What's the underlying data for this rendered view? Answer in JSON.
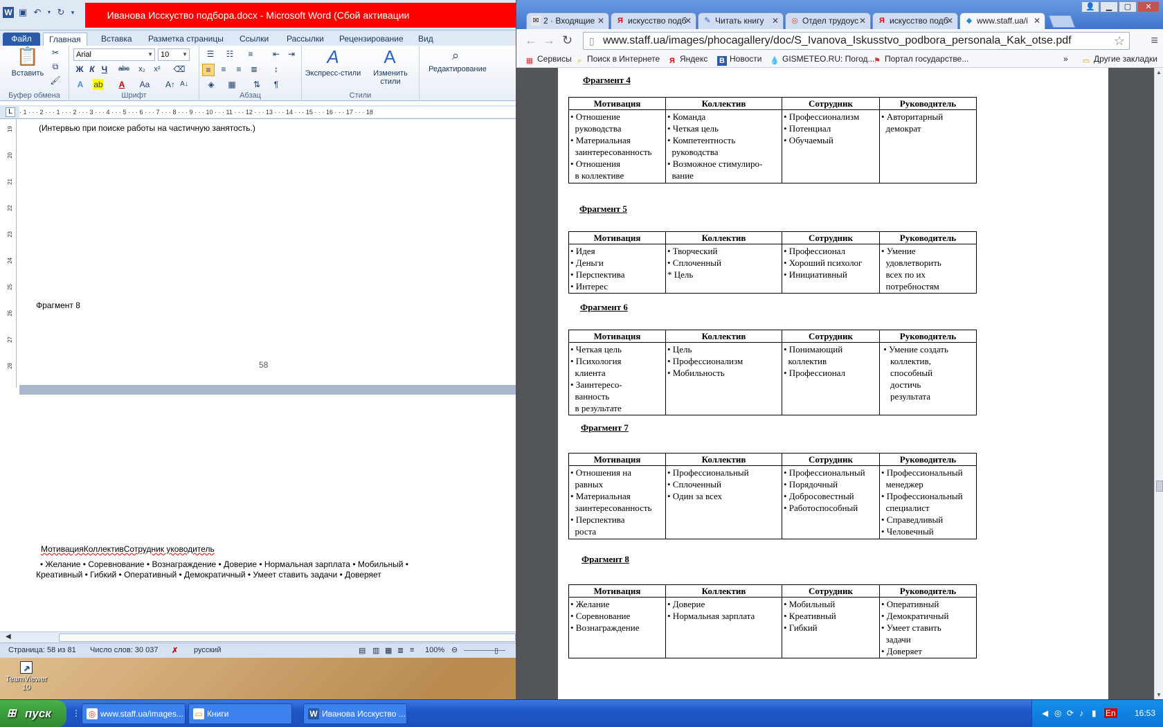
{
  "word": {
    "title": "Иванова Исскуство подбора.docx - Microsoft Word (Сбой активации продукта)",
    "tabs": [
      {
        "label": "Файл"
      },
      {
        "label": "Главная"
      },
      {
        "label": "Вставка"
      },
      {
        "label": "Разметка страницы"
      },
      {
        "label": "Ссылки"
      },
      {
        "label": "Рассылки"
      },
      {
        "label": "Рецензирование"
      },
      {
        "label": "Вид"
      }
    ],
    "ribbon": {
      "paste_label": "Вставить",
      "clipboard_group": "Буфер обмена",
      "font_name": "Arial",
      "font_size": "10",
      "font_group": "Шрифт",
      "bold": "Ж",
      "italic": "К",
      "underline": "Ч",
      "strike": "abc",
      "subscript": "x₂",
      "superscript": "x²",
      "paragraph_group": "Абзац",
      "styles_express": "Экспресс-стили",
      "styles_change": "Изменить стили",
      "styles_group": "Стили",
      "editing": "Редактирование"
    },
    "ruler_marks": "· 1 · · · 2 · · · 1 · · · 2 · · · 3 · · · 4 · · · 5 · · · 6 · · · 7 · · · 8 · · · 9 · · · 10 · · · 11 · · · 12 · · · 13 · · · 14 · · · 15 · · · 16 · · · 17 · · · 18",
    "vruler_marks": [
      "19",
      "20",
      "21",
      "22",
      "23",
      "24",
      "25",
      "26",
      "27",
      "28"
    ],
    "doc": {
      "line_interview": "(Интервью при поиске работы на частичную занятость.)",
      "fragment_label": "Фрагмент 8",
      "page_number": "58",
      "table_header_merged": "МотивацияКоллективСотрудник уководитель",
      "line_items_1": "• Желание  • Соревнование  • Вознаграждение  • Доверие • Нормальная зарплата • Мобильный •",
      "line_items_2": "Креативный  • Гибкий • Оперативный  • Демократичный  • Умеет ставить задачи • Доверяет"
    },
    "status": {
      "page": "Страница: 58 из 81",
      "words": "Число слов: 30 037",
      "language": "русский",
      "zoom": "100%"
    }
  },
  "teamviewer_label": "TeamViewer 10",
  "chrome": {
    "tabs": [
      {
        "label": "2 · Входящие"
      },
      {
        "label": "искусство подб"
      },
      {
        "label": "Читать книгу"
      },
      {
        "label": "Отдел трудоус"
      },
      {
        "label": "искусство подб"
      },
      {
        "label": "www.staff.ua/i"
      }
    ],
    "url": "www.staff.ua/images/phocagallery/doc/S_Ivanova_Iskusstvo_podbora_personala_Kak_otse.pdf",
    "bookmarks": [
      {
        "label": "Сервисы"
      },
      {
        "label": "Поиск в Интернете"
      },
      {
        "label": "Яндекс"
      },
      {
        "label": "Новости"
      },
      {
        "label": "GISMETEO.RU: Погод..."
      },
      {
        "label": "Портал государстве..."
      }
    ],
    "bookmarks_more": "»",
    "other_bookmarks": "Другие закладки"
  },
  "pdf": {
    "headers": [
      "Мотивация",
      "Коллектив",
      "Сотрудник",
      "Руководитель"
    ],
    "fragments": [
      {
        "title": "Фрагмент 4",
        "cols": [
          [
            "• Отношение",
            "  руководства",
            "• Материальная",
            "  заинтересованность",
            "• Отношения",
            "  в коллективе"
          ],
          [
            "• Команда",
            "• Четкая цель",
            "• Компетентность",
            "  руководства",
            "• Возможное стимулиро-",
            "  вание"
          ],
          [
            "• Профессионализм",
            "• Потенциал",
            "• Обучаемый"
          ],
          [
            "• Авторитарный",
            "  демократ"
          ]
        ]
      },
      {
        "title": "Фрагмент 5",
        "cols": [
          [
            "• Идея",
            "• Деньги",
            "• Перспектива",
            "• Интерес"
          ],
          [
            "• Творческий",
            "• Сплоченный",
            "* Цель"
          ],
          [
            "• Профессионал",
            "• Хороший психолог",
            "• Инициативный"
          ],
          [
            "• Умение",
            "  удовлетворить",
            "  всех по их",
            "  потребностям"
          ]
        ]
      },
      {
        "title": "Фрагмент 6",
        "cols": [
          [
            "• Четкая цель",
            "• Психология",
            "  клиента",
            "• Заинтересо-",
            "  ванность",
            "  в результате"
          ],
          [
            "• Цель",
            "• Профессионализм",
            "• Мобильность"
          ],
          [
            "• Понимающий",
            "  коллектив",
            "• Профессионал"
          ],
          [
            " • Умение создать",
            "    коллектив,",
            "    способный",
            "    достичь",
            "    результата"
          ]
        ]
      },
      {
        "title": "Фрагмент 7",
        "cols": [
          [
            "• Отношения на",
            "  равных",
            "• Материальная",
            "  заинтересованность",
            "• Перспектива",
            "  роста"
          ],
          [
            "• Профессиональный",
            "• Сплоченный",
            "• Один за всех"
          ],
          [
            "• Профессиональный",
            "• Порядочный",
            "• Добросовестный",
            "• Работоспособный"
          ],
          [
            "• Профессиональный",
            "  менеджер",
            "• Профессиональный",
            "  специалист",
            "• Справедливый",
            "• Человечный"
          ]
        ]
      },
      {
        "title": "Фрагмент 8",
        "cols": [
          [
            "• Желание",
            "• Соревнование",
            "• Вознаграждение"
          ],
          [
            "• Доверие",
            "• Нормальная зарплата"
          ],
          [
            "• Мобильный",
            "• Креативный",
            "• Гибкий"
          ],
          [
            "• Оперативный",
            "• Демократичный",
            "• Умеет ставить",
            "  задачи",
            "• Доверяет"
          ]
        ]
      }
    ]
  },
  "taskbar": {
    "start": "пуск",
    "items": [
      {
        "label": "www.staff.ua/images..."
      },
      {
        "label": "Книги"
      },
      {
        "label": "Иванова Исскуство ..."
      }
    ],
    "lang": "EN",
    "tray_lang": "En",
    "clock": "16:53"
  }
}
